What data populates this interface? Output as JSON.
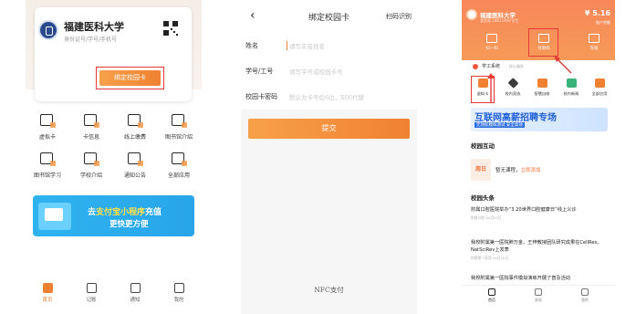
{
  "colors": {
    "accent": "#f08132",
    "highlight_box": "#e53935",
    "banner_blue": "#2fb3f0",
    "header_orange": "#f8875a"
  },
  "panel1": {
    "school_name": "福建医科大学",
    "school_sub": "身份证号/学号/手机号",
    "bind_button": "绑定校园卡",
    "grid_items": [
      {
        "label": "虚拟卡",
        "icon": "virtual-card-icon"
      },
      {
        "label": "卡信息",
        "icon": "card-info-icon"
      },
      {
        "label": "线上缴费",
        "icon": "online-payment-icon"
      },
      {
        "label": "图书馆介绍",
        "icon": "library-icon"
      },
      {
        "label": "图书馆学习",
        "icon": "study-icon"
      },
      {
        "label": "学校介绍",
        "icon": "school-intro-icon"
      },
      {
        "label": "通知公告",
        "icon": "notice-icon"
      },
      {
        "label": "全部应用",
        "icon": "all-apps-icon"
      }
    ],
    "banner": {
      "line1_pre": "去",
      "line1_highlight": "支付宝小程序",
      "line1_post": "充值",
      "line2": "更快更方便"
    },
    "tabbar": [
      {
        "label": "首页",
        "icon": "home-icon",
        "active": true
      },
      {
        "label": "记账",
        "icon": "ledger-icon",
        "active": false
      },
      {
        "label": "通知",
        "icon": "bell-icon",
        "active": false
      },
      {
        "label": "我的",
        "icon": "profile-icon",
        "active": false
      }
    ]
  },
  "panel2": {
    "title": "绑定校园卡",
    "right_action": "扫码识别",
    "fields": [
      {
        "label": "姓名",
        "placeholder": "请写实名姓名"
      },
      {
        "label": "学号/工号",
        "placeholder": "请写学号或校园卡号"
      },
      {
        "label": "校园卡密码",
        "placeholder": "默认为卡号后6位，X00代替"
      }
    ],
    "submit": "提交",
    "nfc": "NFC支付"
  },
  "panel3": {
    "school_name": "福建医科大学",
    "school_sub": "我是谁 18811000 学生",
    "balance": "¥ 5.16",
    "balance_label": "账户余额",
    "quick_actions": [
      {
        "label": "扫一扫",
        "icon": "scan-icon"
      },
      {
        "label": "付款码",
        "icon": "qrcode-icon"
      },
      {
        "label": "充值",
        "icon": "recharge-icon"
      }
    ],
    "system_label": "学工系统",
    "system_sub": "核心服务",
    "apps": [
      {
        "label": "虚拟卡",
        "icon": "virtual-card-icon",
        "color": "#f08132"
      },
      {
        "label": "校内双选",
        "icon": "recruit-icon",
        "color": "#3a3a3a"
      },
      {
        "label": "智慧自修",
        "icon": "self-study-icon",
        "color": "#f08132"
      },
      {
        "label": "校内新闻",
        "icon": "news-icon",
        "color": "#3ab37a"
      },
      {
        "label": "全部应用",
        "icon": "all-apps-icon",
        "color": "#f08132"
      }
    ],
    "banner": {
      "title": "互联网高薪招聘专场",
      "sub": "无领航模拟测试 安全高效"
    },
    "section_campus": "校园互动",
    "course_day": "周日",
    "course_text": "暂无课程，",
    "course_link": "立即添加",
    "section_headlines": "校园头条",
    "news": [
      {
        "title": "附属口腔医院举办“3.20世界口腔健康日”线上义诊",
        "date": "附属口腔 04月20日"
      },
      {
        "title": "我校附属第一医院肺万金、王梓教授团队研究成果在CellRes、NatSciRev上发表",
        "date": "附属第一医院 04月20日"
      },
      {
        "title": "我校附属第一医院事件模拟演练开展了普及活动",
        "date": ""
      }
    ],
    "tabbar": [
      {
        "label": "首页",
        "icon": "home-icon",
        "active": true
      },
      {
        "label": "发现",
        "icon": "discover-icon",
        "active": false
      },
      {
        "label": "我的",
        "icon": "profile-icon",
        "active": false
      }
    ]
  }
}
